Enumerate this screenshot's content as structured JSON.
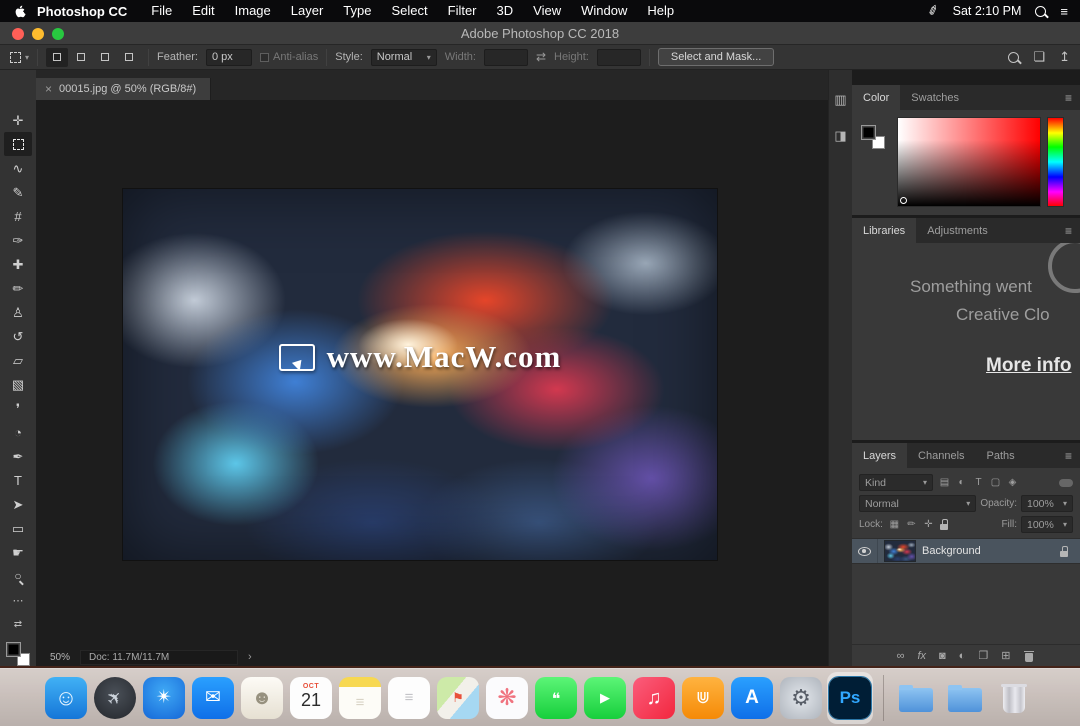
{
  "menu_bar": {
    "app_name": "Photoshop CC",
    "menus": [
      {
        "name": "menu-file",
        "label": "File"
      },
      {
        "name": "menu-edit",
        "label": "Edit"
      },
      {
        "name": "menu-image",
        "label": "Image"
      },
      {
        "name": "menu-layer",
        "label": "Layer"
      },
      {
        "name": "menu-type",
        "label": "Type"
      },
      {
        "name": "menu-select",
        "label": "Select"
      },
      {
        "name": "menu-filter",
        "label": "Filter"
      },
      {
        "name": "menu-3d",
        "label": "3D"
      },
      {
        "name": "menu-view",
        "label": "View"
      },
      {
        "name": "menu-window",
        "label": "Window"
      },
      {
        "name": "menu-help",
        "label": "Help"
      }
    ],
    "clock": "Sat 2:10 PM"
  },
  "window": {
    "title": "Adobe Photoshop CC 2018"
  },
  "options_bar": {
    "feather_label": "Feather:",
    "feather_value": "0 px",
    "antialias_label": "Anti-alias",
    "style_label": "Style:",
    "style_value": "Normal",
    "width_label": "Width:",
    "height_label": "Height:",
    "select_and_mask_label": "Select and Mask...",
    "selection_modes": [
      {
        "name": "new-selection-button",
        "cls": "active"
      },
      {
        "name": "add-to-selection-button"
      },
      {
        "name": "subtract-from-selection-button"
      },
      {
        "name": "intersect-selection-button"
      }
    ]
  },
  "tools": [
    {
      "name": "move-tool",
      "glyph": "✛"
    },
    {
      "name": "rectangular-marquee-tool",
      "cls": "selected marquee"
    },
    {
      "name": "lasso-tool",
      "glyph": "∿"
    },
    {
      "name": "quick-selection-tool",
      "glyph": "✎"
    },
    {
      "name": "crop-tool",
      "glyph": "#"
    },
    {
      "name": "eyedropper-tool",
      "glyph": "✑"
    },
    {
      "name": "spot-healing-brush-tool",
      "glyph": "✚"
    },
    {
      "name": "brush-tool",
      "glyph": "✏"
    },
    {
      "name": "clone-stamp-tool",
      "glyph": "♙"
    },
    {
      "name": "history-brush-tool",
      "glyph": "↺"
    },
    {
      "name": "eraser-tool",
      "glyph": "▱"
    },
    {
      "name": "gradient-tool",
      "glyph": "▧"
    },
    {
      "name": "blur-tool",
      "glyph": "❜"
    },
    {
      "name": "dodge-tool",
      "glyph": "◔"
    },
    {
      "name": "pen-tool",
      "glyph": "✒"
    },
    {
      "name": "type-tool",
      "glyph": "T"
    },
    {
      "name": "path-selection-tool",
      "glyph": "➤"
    },
    {
      "name": "rectangle-tool",
      "glyph": "▭"
    },
    {
      "name": "hand-tool",
      "glyph": "☛"
    },
    {
      "name": "zoom-tool",
      "glyph": "○",
      "cls": "zoom"
    }
  ],
  "document": {
    "tab_title": "00015.jpg @ 50% (RGB/8#)",
    "zoom_level": "50%",
    "doc_info": "Doc: 11.7M/11.7M",
    "watermark_text": "www.MacW.com"
  },
  "color_panel": {
    "tabs": [
      "Color",
      "Swatches"
    ]
  },
  "libraries_panel": {
    "tabs": [
      "Libraries",
      "Adjustments"
    ],
    "message_line1": "Something went",
    "message_line2": "Creative Clo",
    "link_text": "More info"
  },
  "layers_panel": {
    "tabs": [
      "Layers",
      "Channels",
      "Paths"
    ],
    "filter_label": "Kind",
    "filter_icons": [
      {
        "name": "filter-pixel-layers-icon",
        "glyph": "▤"
      },
      {
        "name": "filter-adjustment-layers-icon",
        "glyph": "◐"
      },
      {
        "name": "filter-type-layers-icon",
        "glyph": "T"
      },
      {
        "name": "filter-shape-layers-icon",
        "glyph": "▢"
      },
      {
        "name": "filter-smart-objects-icon",
        "glyph": "◈"
      }
    ],
    "blend_mode": "Normal",
    "opacity_label": "Opacity:",
    "opacity_value": "100%",
    "lock_label": "Lock:",
    "lock_icons": [
      {
        "name": "lock-transparency-icon",
        "glyph": "▦"
      },
      {
        "name": "lock-pixels-icon",
        "glyph": "✏"
      },
      {
        "name": "lock-position-icon",
        "glyph": "✛"
      },
      {
        "name": "lock-all-icon",
        "cls": "padlock-ico"
      }
    ],
    "fill_label": "Fill:",
    "fill_value": "100%",
    "layer_name": "Background",
    "actions": [
      {
        "name": "link-layers-button",
        "glyph": "∞"
      },
      {
        "name": "layer-style-button",
        "glyph": "fx",
        "cls": "italic"
      },
      {
        "name": "layer-mask-button",
        "glyph": "◙"
      },
      {
        "name": "adjustment-layer-button",
        "glyph": "◐"
      },
      {
        "name": "layer-group-button",
        "glyph": "❐"
      },
      {
        "name": "new-layer-button",
        "glyph": "⊞"
      },
      {
        "name": "delete-layer-button",
        "cls": "mini-trash"
      }
    ]
  },
  "icons": {
    "caret_down": "▾",
    "hamburger": "≡",
    "swap_arrows": "⇄",
    "close": "×",
    "chevron": "›",
    "ellipsis": "⋯",
    "share": "↥",
    "workspace": "❏",
    "menubar_pen": "✐",
    "notification": "≡",
    "gutter_top": "▥",
    "gutter_bottom": "◨"
  },
  "dock": {
    "items": [
      {
        "name": "dock-finder",
        "style": "background:linear-gradient(180deg,#41b1f5,#1576d8)",
        "glyph": "☺",
        "glyph_style": "color:#eaf6ff;font-size:22px"
      },
      {
        "name": "dock-launchpad",
        "style": "background:radial-gradient(circle at 50% 40%,#4a5058,#23262b);border-radius:50%",
        "glyph": "✈",
        "glyph_style": "color:#cdd4dc;font-size:18px;transform:rotate(-45deg)"
      },
      {
        "name": "dock-safari",
        "style": "background:radial-gradient(circle at 50% 35%,#3fa9f5,#1668d8)",
        "glyph": "✴",
        "glyph_style": "color:#fff;font-size:19px"
      },
      {
        "name": "dock-mail",
        "style": "background:linear-gradient(180deg,#2aa0ff,#0f6fe8)",
        "glyph": "✉",
        "glyph_style": "color:#fff;font-size:19px"
      },
      {
        "name": "dock-contacts",
        "style": "background:linear-gradient(180deg,#fdfbf6,#e6e0d2)",
        "glyph": "☻",
        "glyph_style": "color:#97917f;font-size:20px"
      },
      {
        "name": "dock-calendar",
        "style": "background:#fdfdfd",
        "month": "OCT",
        "day": "21",
        "cls": "calendar"
      },
      {
        "name": "dock-notes",
        "style": "background:linear-gradient(180deg,#f7d851 24%,#fdfcf7 24%)",
        "glyph": "≡",
        "glyph_style": "color:#d9d4c6;font-size:15px;margin-top:10px"
      },
      {
        "name": "dock-reminders",
        "style": "background:#fdfdfd",
        "glyph": "≡",
        "glyph_style": "color:#c4c4c8;font-size:15px"
      },
      {
        "name": "dock-maps",
        "style": "background:linear-gradient(130deg,#cdeaa8 38%,#f2f0ea 38% 62%,#a6d8f2 62%)",
        "glyph": "⚑",
        "glyph_style": "color:#e8503a;font-size:13px"
      },
      {
        "name": "dock-photos",
        "style": "background:#fbfbfd",
        "glyph": "❋",
        "glyph_style": "color:#f0737f;font-size:23px"
      },
      {
        "name": "dock-messages",
        "style": "background:linear-gradient(180deg,#5cf577,#17cf3c)",
        "glyph": "❝",
        "glyph_style": "color:#fff;font-size:16px;margin-top:5px"
      },
      {
        "name": "dock-facetime",
        "style": "background:linear-gradient(180deg,#5cf577,#17cf3c)",
        "glyph": "▶",
        "glyph_style": "color:#fff;font-size:13px"
      },
      {
        "name": "dock-music",
        "style": "background:linear-gradient(135deg,#fb5d7c,#f2273e)",
        "glyph": "♫",
        "glyph_style": "color:#fff;font-size:20px"
      },
      {
        "name": "dock-books",
        "style": "background:linear-gradient(180deg,#ffb340,#f58a07)",
        "glyph": "⋓",
        "glyph_style": "color:#fff;font-size:17px"
      },
      {
        "name": "dock-app-store",
        "style": "background:linear-gradient(180deg,#2aa0ff,#0f6fe8)",
        "glyph": "A",
        "glyph_style": "color:#fff;font-size:19px;font-weight:bold"
      },
      {
        "name": "dock-system-preferences",
        "style": "background:radial-gradient(circle,#e3e7ec,#aeb4bc)",
        "glyph": "⚙",
        "glyph_style": "color:#585e68;font-size:22px"
      },
      {
        "name": "dock-photoshop",
        "style": "background:#001e36;outline:1px solid #2b77a8",
        "glyph": "Ps",
        "glyph_style": "color:#31a8ff;font-size:17px;font-weight:bold",
        "cls": "active"
      },
      {
        "name": "dock-separator",
        "cls": "separator"
      },
      {
        "name": "dock-folder-1",
        "cls": "folder"
      },
      {
        "name": "dock-folder-2",
        "cls": "folder"
      },
      {
        "name": "dock-trash",
        "cls": "trash"
      }
    ]
  }
}
